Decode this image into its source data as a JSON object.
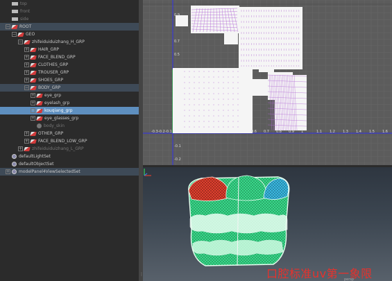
{
  "outliner": {
    "items": [
      {
        "label": "top",
        "indent": 0,
        "icon": "cam",
        "state": "dim",
        "exp": ""
      },
      {
        "label": "front",
        "indent": 0,
        "icon": "cam",
        "state": "dim",
        "exp": ""
      },
      {
        "label": "side",
        "indent": 0,
        "icon": "cam",
        "state": "dim",
        "exp": ""
      },
      {
        "label": "ROOT",
        "indent": 0,
        "icon": "grp",
        "state": "set",
        "exp": "−"
      },
      {
        "label": "GEO",
        "indent": 1,
        "icon": "grp",
        "state": "",
        "exp": "−"
      },
      {
        "label": "zhifeiduiduizhang_H_GRP",
        "indent": 2,
        "icon": "grp",
        "state": "",
        "exp": "−"
      },
      {
        "label": "HAIR_GRP",
        "indent": 3,
        "icon": "grp",
        "state": "",
        "exp": "+"
      },
      {
        "label": "FACE_BLEND_GRP",
        "indent": 3,
        "icon": "grp",
        "state": "",
        "exp": "+"
      },
      {
        "label": "CLOTHES_GRP",
        "indent": 3,
        "icon": "grp",
        "state": "",
        "exp": "+"
      },
      {
        "label": "TROUSER_GRP",
        "indent": 3,
        "icon": "grp",
        "state": "",
        "exp": "+"
      },
      {
        "label": "SHOES_GRP",
        "indent": 3,
        "icon": "grp",
        "state": "",
        "exp": "+"
      },
      {
        "label": "BODY_GRP",
        "indent": 3,
        "icon": "grp",
        "state": "parent",
        "exp": "−"
      },
      {
        "label": "eye_grp",
        "indent": 4,
        "icon": "grp",
        "state": "",
        "exp": "+"
      },
      {
        "label": "eyelash_grp",
        "indent": 4,
        "icon": "grp",
        "state": "",
        "exp": "+"
      },
      {
        "label": "kouqiang_grp",
        "indent": 4,
        "icon": "grp",
        "state": "hi",
        "exp": "+"
      },
      {
        "label": "eye_glasses_grp",
        "indent": 4,
        "icon": "grp",
        "state": "",
        "exp": "+"
      },
      {
        "label": "body_skin",
        "indent": 4,
        "icon": "joint",
        "state": "dim",
        "exp": ""
      },
      {
        "label": "OTHER_GRP",
        "indent": 3,
        "icon": "grp",
        "state": "",
        "exp": "+"
      },
      {
        "label": "FACE_BLEND_LOW_GRP",
        "indent": 3,
        "icon": "grp",
        "state": "",
        "exp": "+"
      },
      {
        "label": "zhifeiduiduizhang_L_GRP",
        "indent": 2,
        "icon": "grp",
        "state": "dim",
        "exp": "+"
      },
      {
        "label": "defaultLightSet",
        "indent": 0,
        "icon": "set",
        "state": "",
        "exp": ""
      },
      {
        "label": "defaultObjectSet",
        "indent": 0,
        "icon": "set",
        "state": "",
        "exp": ""
      },
      {
        "label": "modelPanel4ViewSelectedSet",
        "indent": 0,
        "icon": "set",
        "state": "set",
        "exp": "+"
      }
    ]
  },
  "uv_editor": {
    "x_ticks": [
      "-0.3",
      "-0.2",
      "-0.1",
      "0.6",
      "0.7",
      "0.8",
      "0.9",
      "1",
      "1.1",
      "1.2",
      "1.3",
      "1.4",
      "1.5",
      "1.6"
    ],
    "y_ticks": [
      "0.9",
      "0.7",
      "0.5",
      "-0.1",
      "-0.2"
    ]
  },
  "viewport": {
    "caption": "口腔标准uv第一象限",
    "view_label": "persp"
  },
  "colors": {
    "selection": "#5e8fbf",
    "uv_wire": "#b36bd6",
    "mesh_green": "#39d98a",
    "mesh_blue": "#3ab8e0",
    "mesh_red": "#e0402e",
    "caption": "#e8312c"
  }
}
